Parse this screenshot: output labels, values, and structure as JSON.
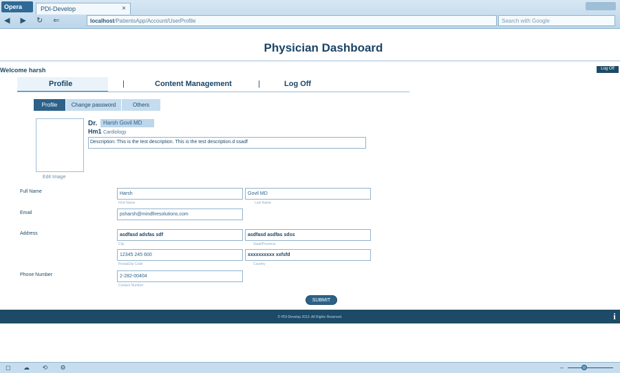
{
  "browser": {
    "logo": "Opera",
    "tab_title": "PDI-Develop",
    "tab_close": "×",
    "nav_glyphs": "◀ ▶ ↻ ⇐",
    "url_host": "localhost",
    "url_path": "/PatientsApp/Account/UserProfile",
    "search_placeholder": "Search with Google"
  },
  "page": {
    "title": "Physician Dashboard",
    "welcome": "Welcome harsh",
    "logout": "Log Off"
  },
  "main_nav": {
    "items": [
      {
        "label": "Profile",
        "active": true
      },
      {
        "label": "Content Management",
        "active": false
      },
      {
        "label": "Log Off",
        "active": false
      }
    ],
    "separator": "|"
  },
  "subtabs": [
    {
      "label": "Profile",
      "active": true
    },
    {
      "label": "Change password",
      "active": false
    },
    {
      "label": "Others",
      "active": false
    }
  ],
  "profile": {
    "edit_image": "Edit Image",
    "dr_label": "Dr.",
    "doctor_name": "Harsh Govil MD",
    "specialty_label": "Hm1",
    "specialty_value": "Cardiology",
    "description": "Description: This is the test description. This is the test description.d ssadf"
  },
  "form": {
    "full_name": {
      "label": "Full Name",
      "first": "Harsh",
      "first_hint": "First Name",
      "last": "Govil MD",
      "last_hint": "Last Name"
    },
    "email": {
      "label": "Email",
      "value": "psharsh@mindfiresolutions.com"
    },
    "address": {
      "label": "Address",
      "city": "asdfasd adsfas sdf",
      "city_hint": "City",
      "state": "asdfasd asdfas sdss",
      "state_hint": "State/Province",
      "postal": "12345 245 600",
      "postal_hint": "Postal/Zip Code",
      "country": "xxxxxxxxxx xxfsfd",
      "country_hint": "Country"
    },
    "phone": {
      "label": "Phone Number",
      "value": "2-282-00404",
      "hint": "Contact Number"
    },
    "submit": "SUBMIT"
  },
  "footer": {
    "text": "© PDI-Develop 2013. All Rights Reserved."
  },
  "statusbar": {
    "icons": "◻ ☁ ⟲ ⚙",
    "zoom_minus": "–"
  }
}
